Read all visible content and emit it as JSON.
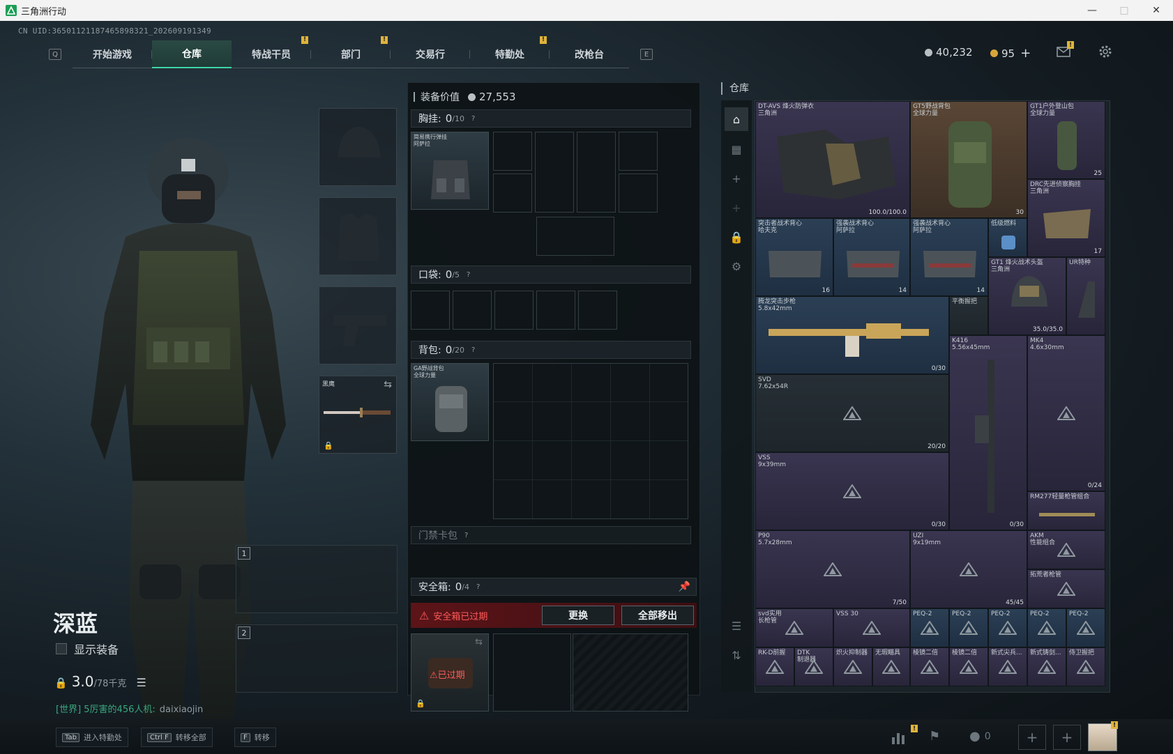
{
  "window": {
    "title": "三角洲行动"
  },
  "header": {
    "uid": "CN UID:365011211874658983​21_202609191349"
  },
  "nav": {
    "left_key": "Q",
    "right_key": "E",
    "tabs": [
      {
        "label": "开始游戏"
      },
      {
        "label": "仓库"
      },
      {
        "label": "特战干员"
      },
      {
        "label": "部门"
      },
      {
        "label": "交易行"
      },
      {
        "label": "特勤处"
      },
      {
        "label": "改枪台"
      }
    ],
    "active_tab": "仓库"
  },
  "currency": {
    "silver": "40,232",
    "gold": "95",
    "add": "+"
  },
  "operator": {
    "name": "深蓝",
    "show_equipment": "显示装备",
    "weight": "3.0",
    "weight_max": "/78千克"
  },
  "chat": {
    "channel": "[世界] 5厉害的456人机:",
    "user": "daixiaojin"
  },
  "slots": {
    "melee_label": "黑鹰",
    "weapon1": "1",
    "weapon2": "2"
  },
  "middle": {
    "value_label": "装备价值",
    "value": "27,553",
    "chest": {
      "label": "胸挂:",
      "count": "0",
      "max": "/10",
      "help": "?",
      "item": "简易携行弹挂\n阿萨拉"
    },
    "pocket": {
      "label": "口袋:",
      "count": "0",
      "max": "/5",
      "help": "?"
    },
    "backpack": {
      "label": "背包:",
      "count": "0",
      "max": "/20",
      "help": "?",
      "item": "GA野战背包\n全球力量"
    },
    "keycard": {
      "label": "门禁卡包",
      "help": "?"
    },
    "safebox": {
      "label": "安全箱:",
      "count": "0",
      "max": "/4",
      "help": "?",
      "expired_text": "安全箱已过期",
      "replace": "更换",
      "move_all": "全部移出",
      "expired_tag": "已过期"
    }
  },
  "warehouse": {
    "title": "仓库",
    "items": [
      {
        "name": "DT-AVS 烽火防弹衣\n三角洲",
        "count": "100.0/100.0"
      },
      {
        "name": "GT5野战背包\n全球力量",
        "count": "30"
      },
      {
        "name": "GT1户外登山包\n全球力量",
        "count": "25"
      },
      {
        "name": "DRC先进侦察胸挂\n三角洲",
        "count": "17"
      },
      {
        "name": "突击者战术背心\n哈夫克",
        "count": "16"
      },
      {
        "name": "强袭战术背心\n阿萨拉",
        "count": "14"
      },
      {
        "name": "强袭战术背心\n阿萨拉",
        "count": "14"
      },
      {
        "name": "低级燃料",
        "count": ""
      },
      {
        "name": "GT1 烽火战术头盔\n三角洲",
        "count": "35.0/35.0"
      },
      {
        "name": "UR特种",
        "count": ""
      },
      {
        "name": "腾龙突击步枪\n5.8x42mm",
        "count": "0/30"
      },
      {
        "name": "平衡握把",
        "count": ""
      },
      {
        "name": "K416\n5.56x45mm",
        "count": "0/30"
      },
      {
        "name": "MK4\n4.6x30mm",
        "count": "0/24"
      },
      {
        "name": "SVD\n7.62x54R",
        "count": "20/20"
      },
      {
        "name": "VSS\n9x39mm",
        "count": "0/30"
      },
      {
        "name": "RM277轻量枪管组合",
        "count": ""
      },
      {
        "name": "P90\n5.7x28mm",
        "count": "7/50"
      },
      {
        "name": "UZI\n9x19mm",
        "count": "45/45"
      },
      {
        "name": "AKM\n性能组合",
        "count": ""
      },
      {
        "name": "拓荒者枪管",
        "count": ""
      },
      {
        "name": "svd实用\n长枪管",
        "count": ""
      },
      {
        "name": "VSS 30",
        "count": ""
      },
      {
        "name": "PEQ-2",
        "count": ""
      },
      {
        "name": "PEQ-2",
        "count": ""
      },
      {
        "name": "PEQ-2",
        "count": ""
      },
      {
        "name": "PEQ-2",
        "count": ""
      },
      {
        "name": "PEQ-2",
        "count": ""
      },
      {
        "name": "RK-D前握",
        "count": ""
      },
      {
        "name": "DTK\n制退器",
        "count": ""
      },
      {
        "name": "炽火抑制器",
        "count": ""
      },
      {
        "name": "无瑕瞄具",
        "count": ""
      },
      {
        "name": "棱镜二倍",
        "count": ""
      },
      {
        "name": "棱镜二倍",
        "count": ""
      },
      {
        "name": "新式尖兵...",
        "count": ""
      },
      {
        "name": "新式铸剑...",
        "count": ""
      },
      {
        "name": "侍卫握把",
        "count": ""
      }
    ]
  },
  "bottom": {
    "hints": [
      {
        "key": "Tab",
        "label": "进入特勤处"
      },
      {
        "key": "Ctrl F",
        "label": "转移全部"
      },
      {
        "key": "F",
        "label": "转移"
      }
    ],
    "friends": "0"
  },
  "colors": {
    "accent": "#3fd6a6",
    "warn": "#e0b43a",
    "danger": "#ff5a5a"
  }
}
